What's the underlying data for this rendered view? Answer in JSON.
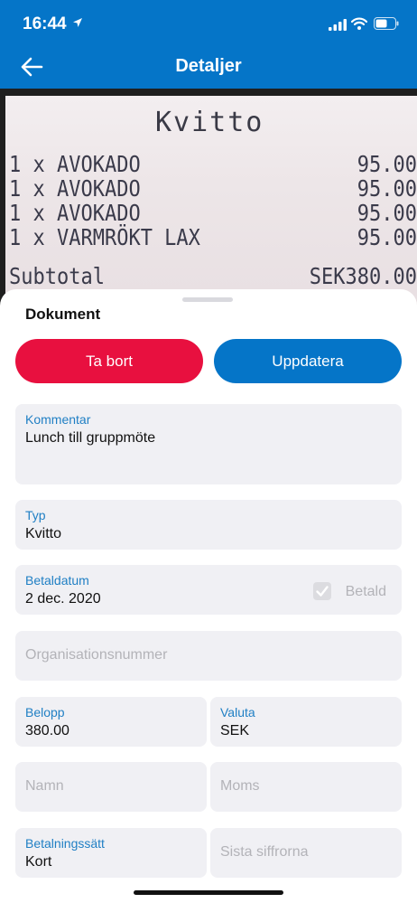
{
  "status": {
    "time": "16:44"
  },
  "nav": {
    "title": "Detaljer"
  },
  "receipt": {
    "title": "Kvitto",
    "lines": [
      {
        "left": "1 x AVOKADO",
        "right": "95.00"
      },
      {
        "left": "1 x AVOKADO",
        "right": "95.00"
      },
      {
        "left": "1 x AVOKADO",
        "right": "95.00"
      },
      {
        "left": "1 x VARMRÖKT LAX",
        "right": "95.00"
      },
      {
        "left": "Subtotal",
        "right": "SEK380.00"
      }
    ]
  },
  "sheet": {
    "section_title": "Dokument",
    "delete_label": "Ta bort",
    "update_label": "Uppdatera"
  },
  "fields": {
    "comment": {
      "label": "Kommentar",
      "value": "Lunch till gruppmöte"
    },
    "type": {
      "label": "Typ",
      "value": "Kvitto"
    },
    "paydate": {
      "label": "Betaldatum",
      "value": "2 dec. 2020"
    },
    "paid": {
      "label": "Betald"
    },
    "orgnr": {
      "placeholder": "Organisationsnummer"
    },
    "amount": {
      "label": "Belopp",
      "value": "380.00"
    },
    "currency": {
      "label": "Valuta",
      "value": "SEK"
    },
    "name": {
      "placeholder": "Namn"
    },
    "vat": {
      "placeholder": "Moms"
    },
    "paymethod": {
      "label": "Betalningssätt",
      "value": "Kort"
    },
    "lastdigits": {
      "placeholder": "Sista siffrorna"
    }
  },
  "colors": {
    "primary": "#0575c8",
    "danger": "#e8103f",
    "label": "#1f7fc4"
  }
}
